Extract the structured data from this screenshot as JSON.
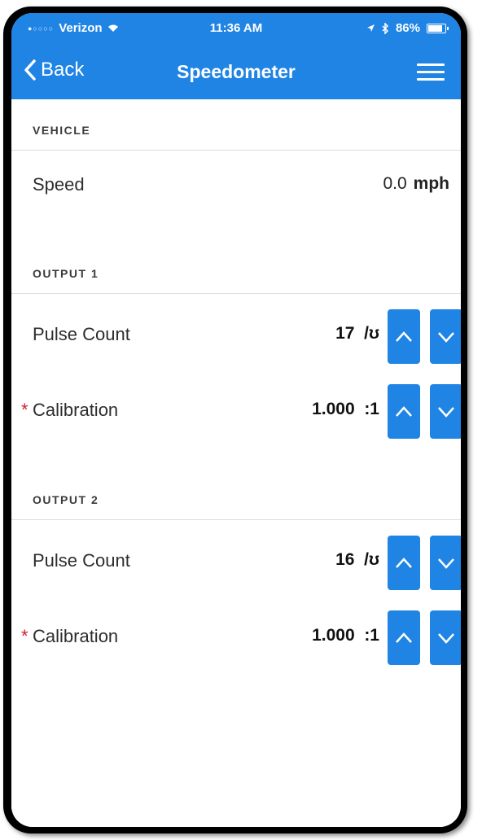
{
  "status_bar": {
    "carrier": "Verizon",
    "time": "11:36 AM",
    "battery": "86%"
  },
  "nav": {
    "back_label": "Back",
    "title": "Speedometer"
  },
  "vehicle": {
    "header": "VEHICLE",
    "speed_label": "Speed",
    "speed_value": "0.0",
    "speed_unit": "mph"
  },
  "output1": {
    "header": "OUTPUT 1",
    "pulse_label": "Pulse Count",
    "pulse_value": "17",
    "pulse_unit": "/ʊ",
    "calibration_label": "Calibration",
    "calibration_value": "1.000",
    "calibration_unit": ":1",
    "required_marker": "*"
  },
  "output2": {
    "header": "OUTPUT 2",
    "pulse_label": "Pulse Count",
    "pulse_value": "16",
    "pulse_unit": "/ʊ",
    "calibration_label": "Calibration",
    "calibration_value": "1.000",
    "calibration_unit": ":1",
    "required_marker": "*"
  },
  "colors": {
    "accent": "#1f84e4",
    "required": "#cc2233"
  }
}
